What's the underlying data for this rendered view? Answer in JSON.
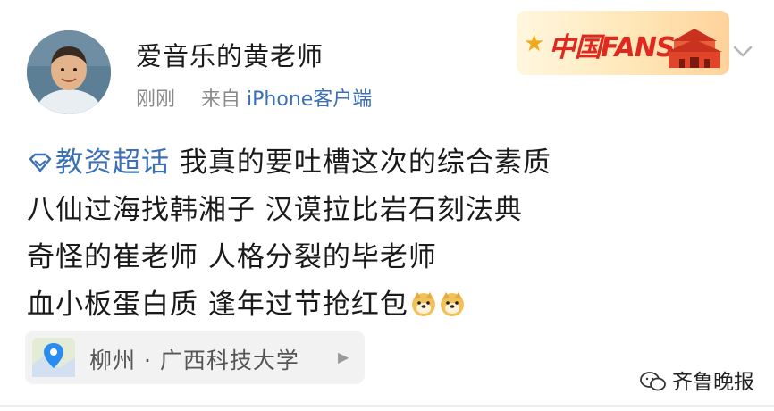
{
  "post": {
    "author": {
      "name": "爱音乐的黄老师"
    },
    "meta": {
      "time": "刚刚",
      "source_prefix": "来自",
      "source": "iPhone客户端"
    },
    "badge": {
      "text": "中国FANS"
    },
    "content": {
      "topic": "教资超话",
      "line1_rest": " 我真的要吐槽这次的综合素质",
      "line2": "八仙过海找韩湘子 汉谟拉比岩石刻法典",
      "line3": " 奇怪的崔老师 人格分裂的毕老师",
      "line4": "血小板蛋白质 逢年过节抢红包"
    },
    "location": {
      "text": "柳州 · 广西科技大学"
    }
  },
  "watermark": {
    "text": "齐鲁晚报"
  },
  "icons": {
    "topic": "diamond-topic-icon",
    "location": "location-pin-icon",
    "expand": "chevron-down-icon",
    "emoji": "doge-emoji-icon",
    "watermark": "wechat-icon"
  },
  "colors": {
    "link": "#3b6fb6",
    "meta": "#8a8a8a",
    "badge_red": "#e0281f"
  }
}
